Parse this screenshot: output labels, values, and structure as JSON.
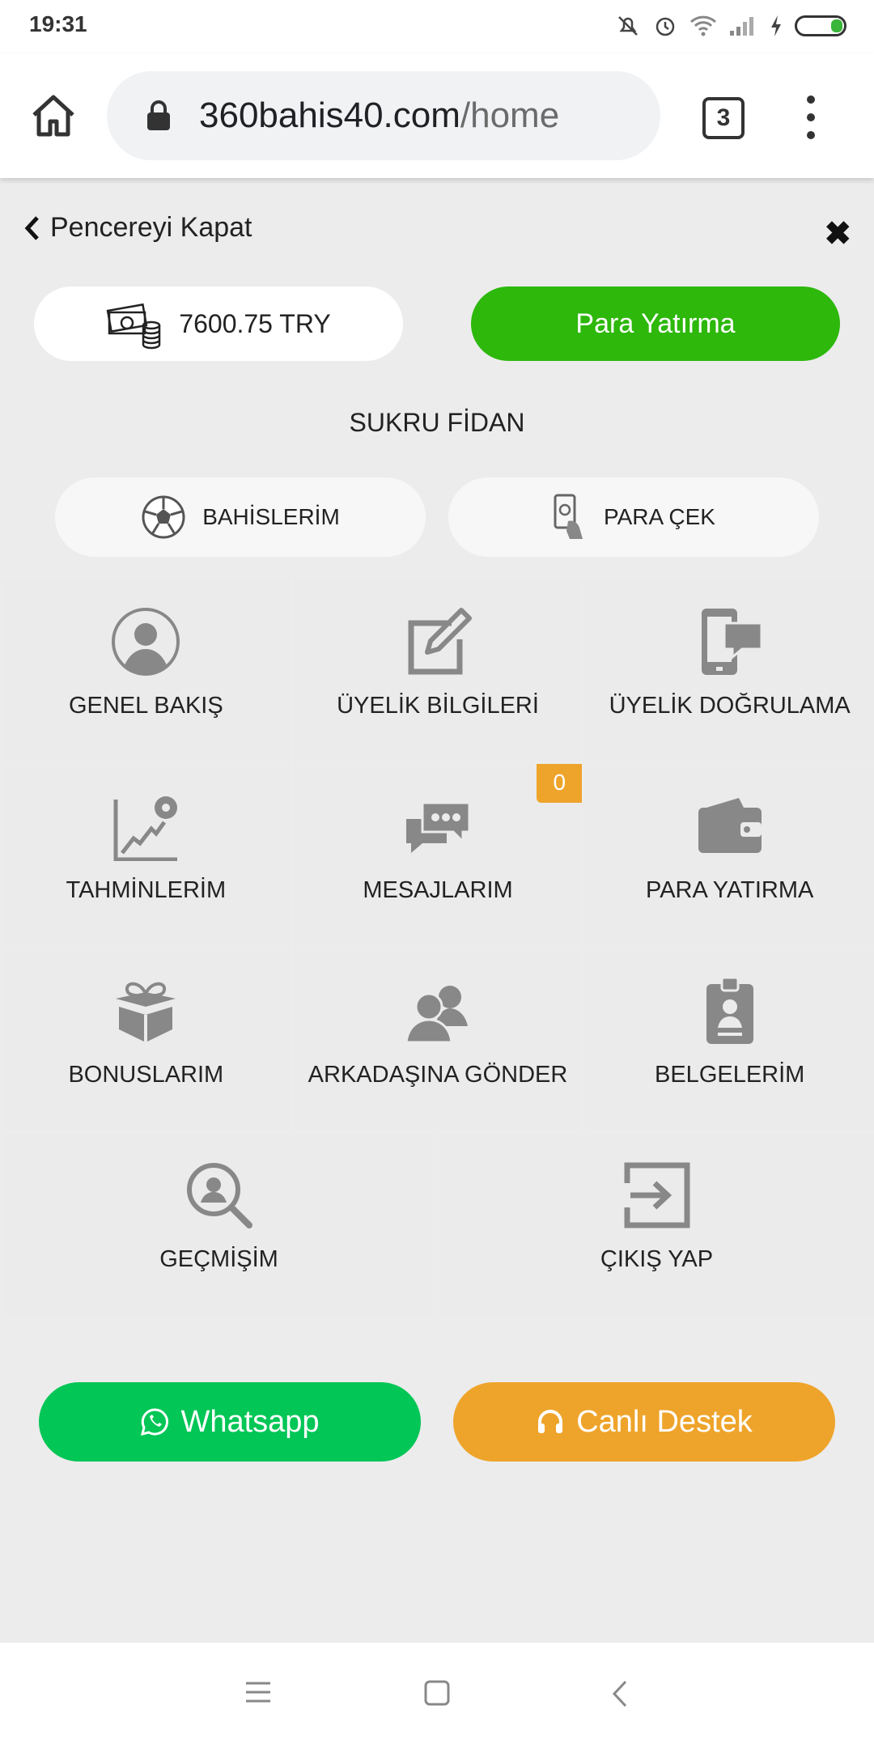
{
  "status": {
    "time": "19:31"
  },
  "browser": {
    "url_domain": "360bahis40.com",
    "url_path": "/home",
    "tab_count": "3"
  },
  "panel": {
    "close_label": "Pencereyi Kapat",
    "balance": "7600.75 TRY",
    "deposit_label": "Para Yatırma",
    "user_name": "SUKRU FİDAN",
    "pill_bets": "BAHİSLERİM",
    "pill_withdraw": "PARA ÇEK"
  },
  "menu": {
    "items": [
      {
        "label": "GENEL BAKIŞ",
        "icon": "user-circle-icon"
      },
      {
        "label": "ÜYELİK BİLGİLERİ",
        "icon": "edit-icon"
      },
      {
        "label": "ÜYELİK DOĞRULAMA",
        "icon": "phone-message-icon"
      },
      {
        "label": "TAHMİNLERİM",
        "icon": "chart-ball-icon"
      },
      {
        "label": "MESAJLARIM",
        "icon": "chat-icon",
        "badge": "0"
      },
      {
        "label": "PARA YATIRMA",
        "icon": "wallet-icon"
      },
      {
        "label": "BONUSLARIM",
        "icon": "gift-icon"
      },
      {
        "label": "ARKADAŞINA GÖNDER",
        "icon": "users-icon"
      },
      {
        "label": "BELGELERİM",
        "icon": "id-badge-icon"
      },
      {
        "label": "GEÇMİŞİM",
        "icon": "search-user-icon"
      },
      {
        "label": "ÇIKIŞ YAP",
        "icon": "logout-icon"
      }
    ]
  },
  "footer": {
    "whatsapp_label": "Whatsapp",
    "live_support_label": "Canlı Destek"
  },
  "colors": {
    "green": "#2db80b",
    "whatsapp": "#02c656",
    "orange": "#eea42b",
    "icon_gray": "#8a8a8a"
  }
}
